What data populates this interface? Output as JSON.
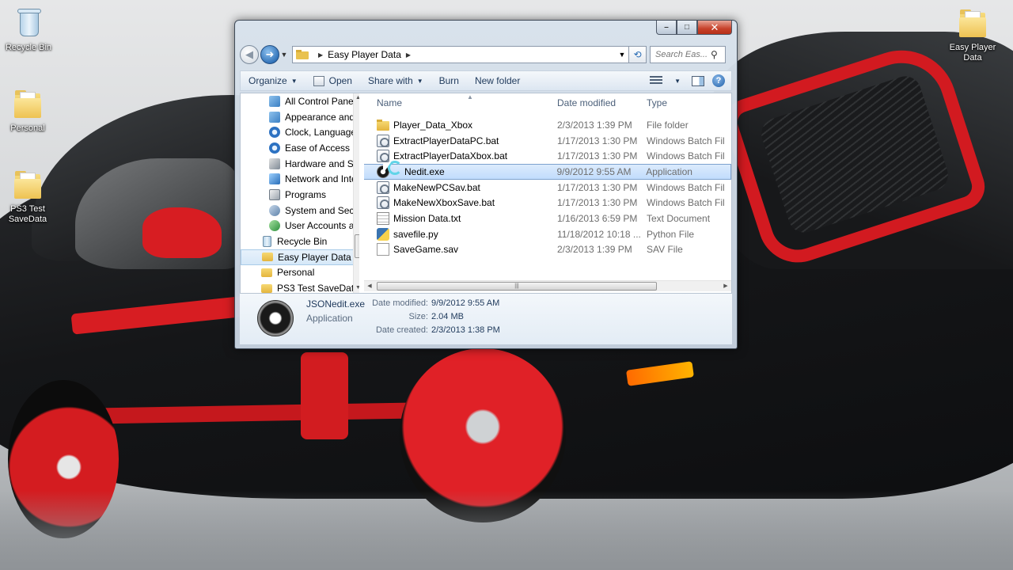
{
  "desktop": {
    "icons": [
      {
        "label": "Recycle Bin",
        "icon": "recycle-bin-icon"
      },
      {
        "label": "Personal",
        "icon": "folder-icon"
      },
      {
        "label": "PS3 Test SaveData",
        "icon": "folder-icon"
      },
      {
        "label": "Easy Player Data",
        "icon": "folder-icon"
      }
    ]
  },
  "window": {
    "caption": {
      "minimize": "–",
      "maximize": "□",
      "close": "✕"
    },
    "address": {
      "folder": "Easy Player Data"
    },
    "search": {
      "placeholder": "Search Eas..."
    },
    "toolbar": {
      "organize": "Organize",
      "open": "Open",
      "share_with": "Share with",
      "burn": "Burn",
      "new_folder": "New folder"
    },
    "nav_items": [
      {
        "label": "All Control Panel",
        "level": 2
      },
      {
        "label": "Appearance and",
        "level": 2
      },
      {
        "label": "Clock, Language,",
        "level": 2
      },
      {
        "label": "Ease of Access",
        "level": 2
      },
      {
        "label": "Hardware and So",
        "level": 2
      },
      {
        "label": "Network and Inte",
        "level": 2
      },
      {
        "label": "Programs",
        "level": 2
      },
      {
        "label": "System and Secu",
        "level": 2
      },
      {
        "label": "User Accounts ar",
        "level": 2
      },
      {
        "label": "Recycle Bin",
        "level": 1
      },
      {
        "label": "Easy Player Data",
        "level": 1,
        "selected": true
      },
      {
        "label": "Personal",
        "level": 1
      },
      {
        "label": "PS3 Test SaveData",
        "level": 1
      }
    ],
    "columns": {
      "name": "Name",
      "date": "Date modified",
      "type": "Type"
    },
    "files": [
      {
        "name": "Player_Data_Xbox",
        "date": "2/3/2013 1:39 PM",
        "type": "File folder",
        "icon": "folder-icon"
      },
      {
        "name": "ExtractPlayerDataPC.bat",
        "date": "1/17/2013 1:30 PM",
        "type": "Windows Batch Fil",
        "icon": "batch-file-icon"
      },
      {
        "name": "ExtractPlayerDataXbox.bat",
        "date": "1/17/2013 1:30 PM",
        "type": "Windows Batch Fil",
        "icon": "batch-file-icon"
      },
      {
        "name": "Nedit.exe",
        "date": "9/9/2012 9:55 AM",
        "type": "Application",
        "icon": "application-icon",
        "selected": true
      },
      {
        "name": "MakeNewPCSav.bat",
        "date": "1/17/2013 1:30 PM",
        "type": "Windows Batch Fil",
        "icon": "batch-file-icon"
      },
      {
        "name": "MakeNewXboxSave.bat",
        "date": "1/17/2013 1:30 PM",
        "type": "Windows Batch Fil",
        "icon": "batch-file-icon"
      },
      {
        "name": "Mission Data.txt",
        "date": "1/16/2013 6:59 PM",
        "type": "Text Document",
        "icon": "text-file-icon"
      },
      {
        "name": "savefile.py",
        "date": "11/18/2012 10:18 ...",
        "type": "Python File",
        "icon": "python-file-icon"
      },
      {
        "name": "SaveGame.sav",
        "date": "2/3/2013 1:39 PM",
        "type": "SAV File",
        "icon": "generic-file-icon"
      }
    ],
    "details": {
      "name": "JSONedit.exe",
      "type": "Application",
      "date_modified_label": "Date modified:",
      "date_modified": "9/9/2012 9:55 AM",
      "size_label": "Size:",
      "size": "2.04 MB",
      "date_created_label": "Date created:",
      "date_created": "2/3/2013 1:38 PM"
    }
  }
}
